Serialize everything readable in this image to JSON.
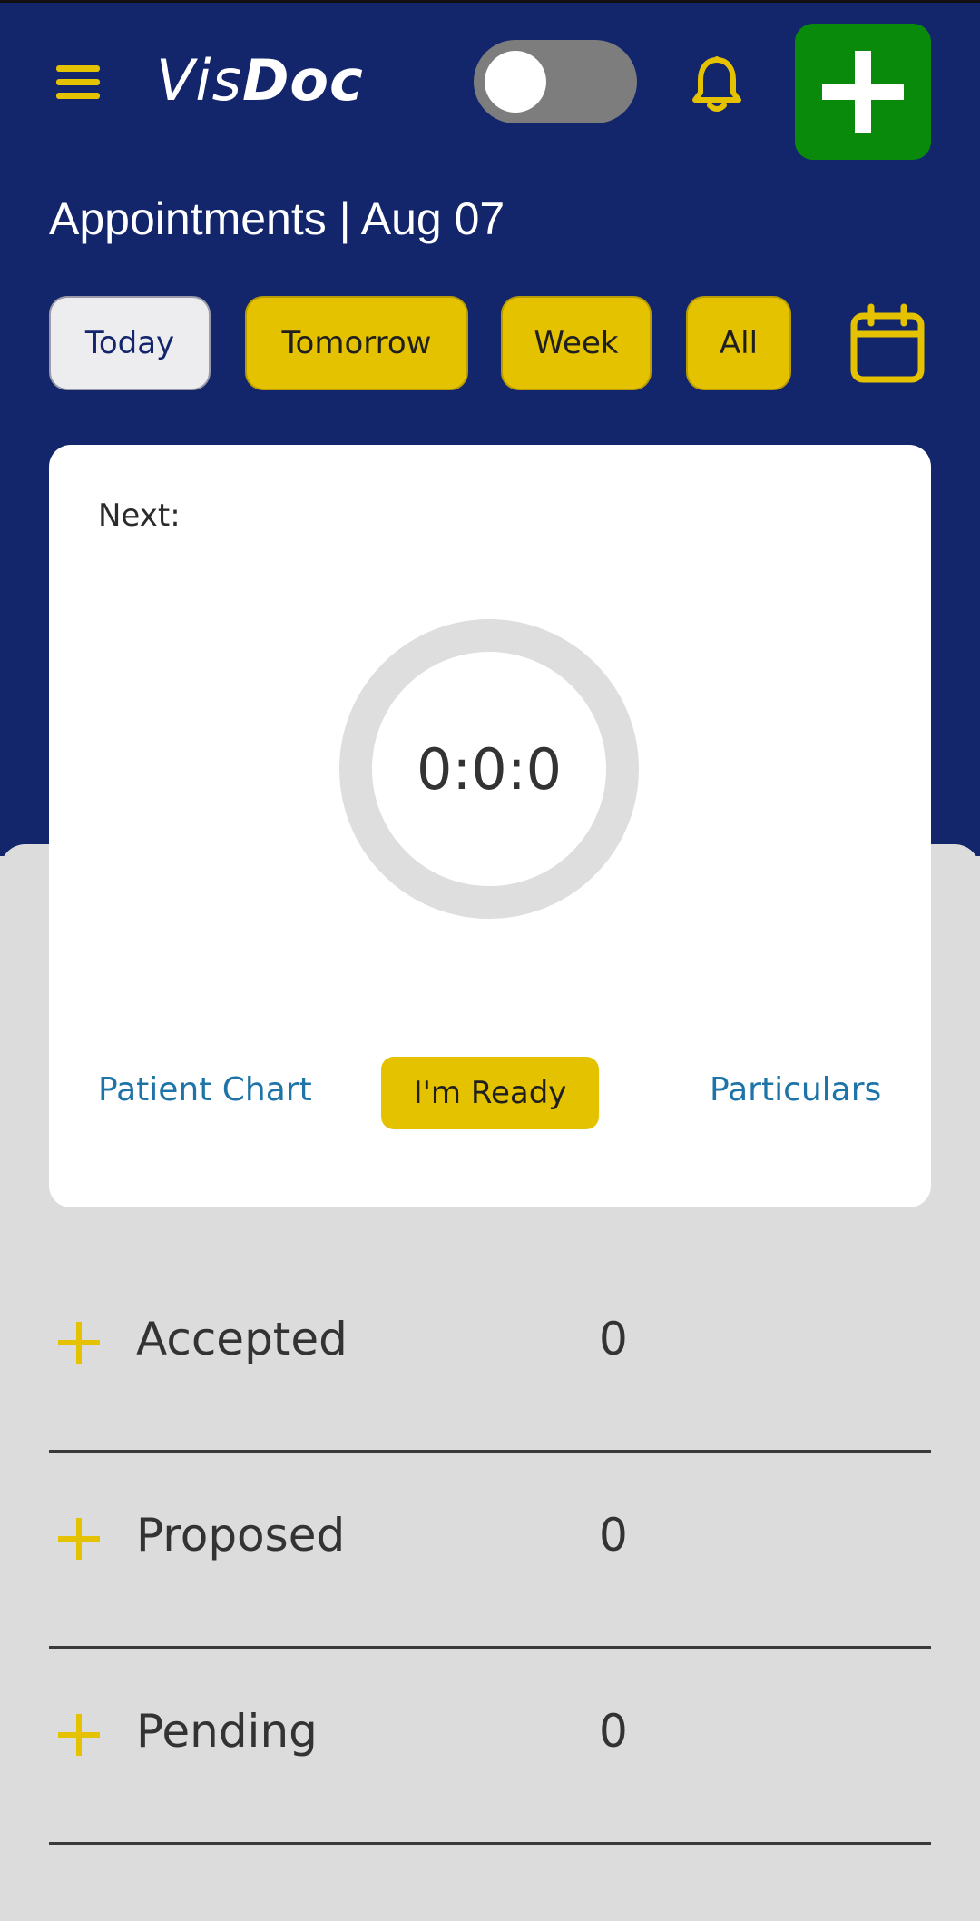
{
  "header": {
    "logo_light": "Vis",
    "logo_bold": "Doc",
    "title": "Appointments | Aug 07"
  },
  "filters": [
    {
      "label": "Today",
      "active": true
    },
    {
      "label": "Tomorrow",
      "active": false
    },
    {
      "label": "Week",
      "active": false
    },
    {
      "label": "All",
      "active": false
    }
  ],
  "next_card": {
    "label": "Next:",
    "timer": "0:0:0",
    "patient_chart": "Patient Chart",
    "ready": "I'm Ready",
    "particulars": "Particulars"
  },
  "statuses": [
    {
      "label": "Accepted",
      "count": "0"
    },
    {
      "label": "Proposed",
      "count": "0"
    },
    {
      "label": "Pending",
      "count": "0"
    }
  ],
  "colors": {
    "primary": "#13256b",
    "accent": "#e4c200",
    "add_button": "#0a8a0a",
    "link": "#1e74a8"
  },
  "icons": [
    "menu-icon",
    "toggle-switch",
    "bell-icon",
    "plus-icon",
    "calendar-icon"
  ]
}
